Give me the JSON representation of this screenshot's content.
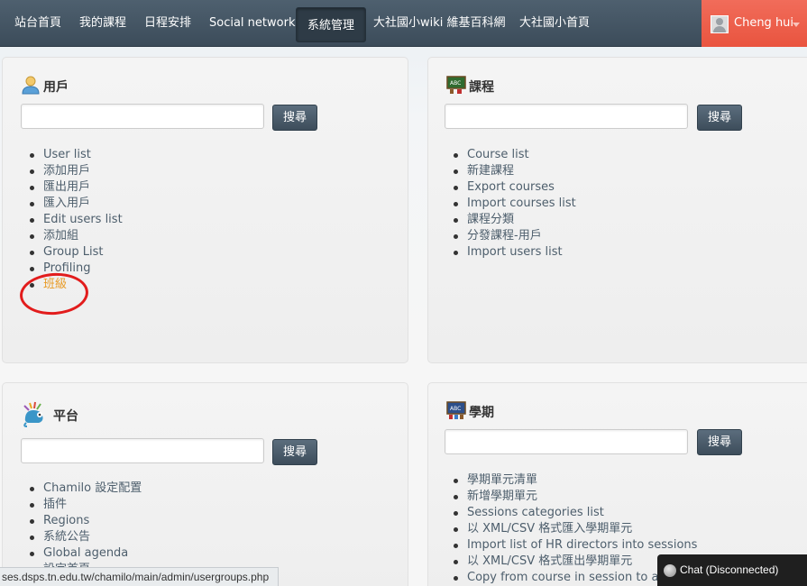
{
  "nav": {
    "items": [
      "站台首頁",
      "我的課程",
      "日程安排",
      "Social network",
      "系統管理",
      "大社國小wiki 維基百科網",
      "大社國小首頁"
    ],
    "user_name": "Cheng hui"
  },
  "search_button": "搜尋",
  "panels": {
    "users": {
      "title": "用戶",
      "links": [
        "User list",
        "添加用戶",
        "匯出用戶",
        "匯入用戶",
        "Edit users list",
        "添加組",
        "Group List",
        "Profiling",
        "班級"
      ]
    },
    "courses": {
      "title": "課程",
      "links": [
        "Course list",
        "新建課程",
        "Export courses",
        "Import courses list",
        "課程分類",
        "分發課程-用戶",
        "Import users list"
      ]
    },
    "platform": {
      "title": "平台",
      "links": [
        "Chamilo 設定配置",
        "插件",
        "Regions",
        "系統公告",
        "Global agenda",
        "設定首頁"
      ]
    },
    "sessions": {
      "title": "學期",
      "links": [
        "學期單元清單",
        "新增學期單元",
        "Sessions categories list",
        "以 XML/CSV 格式匯入學期單元",
        "Import list of HR directors into sessions",
        "以 XML/CSV 格式匯出學期單元",
        "Copy from course in session to another session"
      ]
    }
  },
  "status_url": "ses.dsps.tn.edu.tw/chamilo/main/admin/usergroups.php",
  "chat_label": "Chat (Disconnected)",
  "colors": {
    "navbar": "#44545f",
    "user_box": "#ee5f4b",
    "link": "#4d5e6c",
    "active_link": "#e89b26",
    "highlight_circle": "#e21c1c"
  }
}
